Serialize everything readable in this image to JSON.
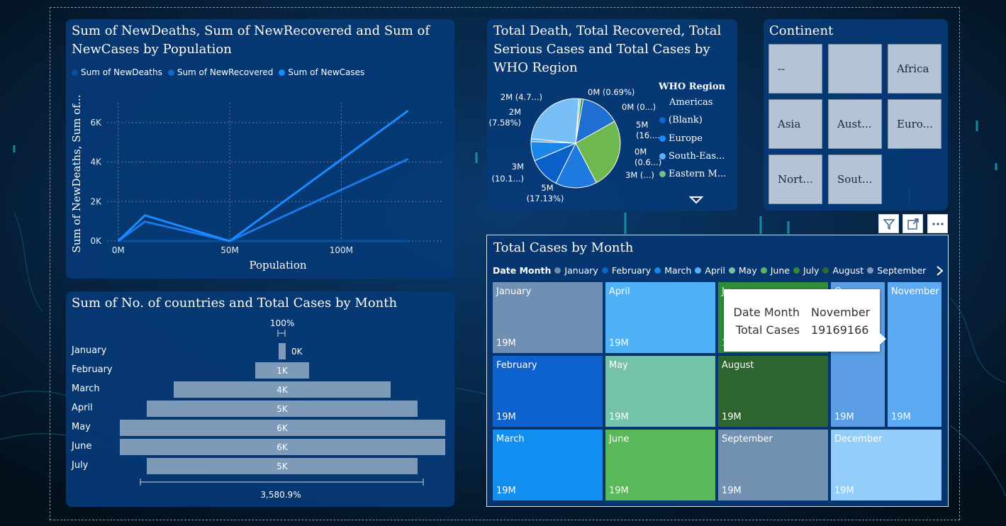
{
  "chart1": {
    "title_line1": "Sum of NewDeaths, Sum of NewRecovered and Sum of",
    "title_line2": "NewCases by Population",
    "legend": [
      "Sum of NewDeaths",
      "Sum of NewRecovered",
      "Sum of NewCases"
    ],
    "xlabel": "Population",
    "ylabel": "Sum of NewDeaths, Sum of...",
    "yticks": [
      "0K",
      "2K",
      "4K",
      "6K"
    ],
    "xticks": [
      "0M",
      "50M",
      "100M"
    ]
  },
  "chart2": {
    "title_line1": "Total Death, Total Recovered, Total",
    "title_line2": "Serious Cases and Total Cases by",
    "title_line3": "WHO Region",
    "legend_title": "WHO Region",
    "legend": [
      "Americas",
      "(Blank)",
      "Europe",
      "South-Eas...",
      "Eastern M..."
    ],
    "labels": {
      "l1": "0M (0.69%)",
      "l2": "0M (0...)",
      "l3a": "5M",
      "l3b": "(16....",
      "l4a": "0M",
      "l4b": "(0.6...)",
      "l5": "3M (...)",
      "l6a": "5M",
      "l6b": "(17.13%)",
      "l7a": "3M",
      "l7b": "(10.1...)",
      "l8a": "2M",
      "l8b": "(7.58%)",
      "l9": "2M (4.7...)"
    }
  },
  "continent": {
    "title": "Continent",
    "items": [
      "--",
      "",
      "Africa",
      "Asia",
      "Aust...",
      "Euro...",
      "Nort...",
      "Sout..."
    ]
  },
  "chart3": {
    "title": "Sum of No. of countries and Total Cases by Month",
    "top_label": "100%",
    "bottom_label": "3,580.9%"
  },
  "chart4": {
    "title": "Total Cases by Month",
    "legend_title": "Date Month",
    "legend": [
      "January",
      "February",
      "March",
      "April",
      "May",
      "June",
      "July",
      "August",
      "September"
    ],
    "cells": [
      {
        "name": "January",
        "value": "19M"
      },
      {
        "name": "February",
        "value": "19M"
      },
      {
        "name": "March",
        "value": "19M"
      },
      {
        "name": "April",
        "value": "19M"
      },
      {
        "name": "May",
        "value": "19M"
      },
      {
        "name": "June",
        "value": "19M"
      },
      {
        "name": "August",
        "value": "19M"
      },
      {
        "name": "September",
        "value": "19M"
      },
      {
        "name": "October",
        "value": "19M"
      },
      {
        "name": "November",
        "value": "19M"
      },
      {
        "name": "December",
        "value": "19M"
      }
    ],
    "partial_label_july": "Ju",
    "partial_label_october": "O",
    "partial_value_july": "1"
  },
  "tooltip": {
    "k1": "Date Month",
    "v1": "November",
    "k2": "Total Cases",
    "v2": "19169166"
  },
  "colors": {
    "tile": "#073a76",
    "line": "#1a8cff",
    "accent": "#00e5d0"
  },
  "icons": [
    "filter-icon",
    "focus-mode-icon",
    "more-options-icon",
    "legend-next-icon",
    "dropdown-arrow-icon"
  ],
  "chart_data": [
    {
      "type": "line",
      "title": "Sum of NewDeaths, Sum of NewRecovered and Sum of NewCases by Population",
      "xlabel": "Population",
      "ylabel": "Sum of NewDeaths, Sum of...",
      "xlim": [
        -5,
        145
      ],
      "ylim": [
        0,
        7000
      ],
      "series": [
        {
          "name": "Sum of NewDeaths",
          "x": [
            0,
            12,
            50,
            130
          ],
          "y": [
            0,
            0,
            0,
            0
          ]
        },
        {
          "name": "Sum of NewRecovered",
          "x": [
            0,
            12,
            50,
            130
          ],
          "y": [
            0,
            980,
            0,
            4150
          ]
        },
        {
          "name": "Sum of NewCases",
          "x": [
            0,
            12,
            50,
            130
          ],
          "y": [
            0,
            1300,
            0,
            6600
          ]
        }
      ],
      "legend": "top"
    },
    {
      "type": "pie",
      "title": "Total Death, Total Recovered, Total Serious Cases and Total Cases by WHO Region",
      "labels": [
        "0M (0.69%)",
        "0M (0...)",
        "5M (16....",
        "0M (0.6...)",
        "3M (...)",
        "5M (17.13%)",
        "3M (10.1...)",
        "2M (7.58%)",
        "2M (4.7...)"
      ],
      "values": [
        0.69,
        0.5,
        16.5,
        0.6,
        9.5,
        17.13,
        10.1,
        7.58,
        4.7
      ],
      "legend": "right"
    },
    {
      "type": "bar",
      "title": "Sum of No. of countries and Total Cases by Month",
      "categories": [
        "January",
        "February",
        "March",
        "April",
        "May",
        "June",
        "July"
      ],
      "values": [
        0,
        1000,
        4000,
        5000,
        6000,
        6000,
        5000
      ],
      "value_labels": [
        "0K",
        "1K",
        "4K",
        "5K",
        "6K",
        "6K",
        "5K"
      ]
    },
    {
      "type": "heatmap",
      "title": "Total Cases by Month",
      "categories": [
        "January",
        "February",
        "March",
        "April",
        "May",
        "June",
        "July",
        "August",
        "September",
        "October",
        "November",
        "December"
      ],
      "values": [
        19,
        19,
        19,
        19,
        19,
        19,
        19,
        19,
        19,
        19,
        19.17,
        19
      ]
    }
  ]
}
